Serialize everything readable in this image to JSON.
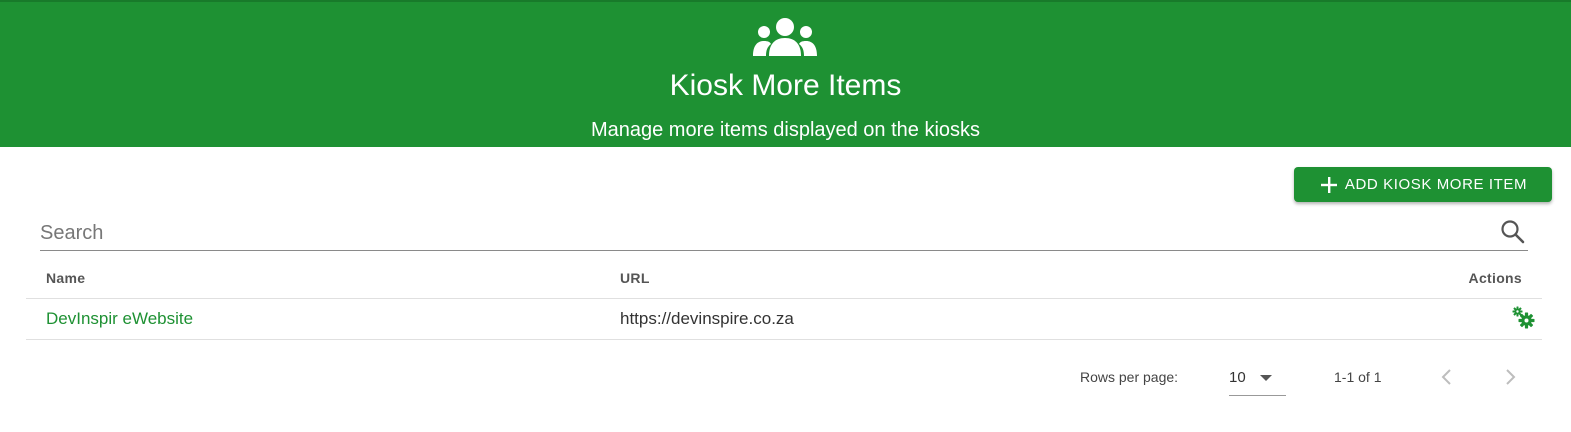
{
  "header": {
    "title": "Kiosk More Items",
    "subtitle": "Manage more items displayed on the kiosks",
    "icon": "users-group-icon"
  },
  "toolbar": {
    "add_label": "ADD KIOSK MORE ITEM",
    "add_icon": "plus-icon"
  },
  "search": {
    "placeholder": "Search",
    "value": "",
    "icon": "search-icon"
  },
  "table": {
    "columns": [
      "Name",
      "URL",
      "Actions"
    ],
    "rows": [
      {
        "name": "DevInspir eWebsite",
        "url": "https://devinspire.co.za",
        "action_icon": "gears-icon"
      }
    ]
  },
  "pagination": {
    "rows_per_page_label": "Rows per page:",
    "rows_per_page_value": "10",
    "range_text": "1-1 of 1"
  },
  "colors": {
    "brand": "#1e9133",
    "header_text": "#ffffff",
    "link": "#1e9133"
  }
}
